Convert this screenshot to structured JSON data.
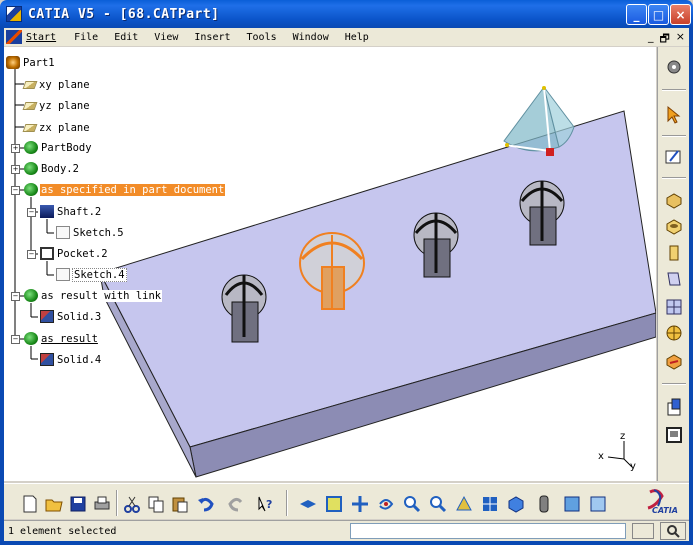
{
  "window": {
    "title": "CATIA V5 - [68.CATPart]",
    "min_symbol": "_",
    "max_symbol": "□",
    "close_symbol": "×"
  },
  "menu": {
    "items": [
      "Start",
      "File",
      "Edit",
      "View",
      "Insert",
      "Tools",
      "Window",
      "Help"
    ],
    "mdi_min": "_",
    "mdi_restore": "🗗",
    "mdi_close": "×"
  },
  "tree": {
    "root": "Part1",
    "nodes": [
      {
        "label": "xy plane",
        "icon": "plane-icon"
      },
      {
        "label": "yz plane",
        "icon": "plane-icon"
      },
      {
        "label": "zx plane",
        "icon": "plane-icon"
      },
      {
        "label": "PartBody",
        "icon": "body-icon"
      },
      {
        "label": "Body.2",
        "icon": "body-icon"
      },
      {
        "label": "as specified in part document",
        "icon": "body-icon"
      },
      {
        "label": "Shaft.2",
        "icon": "shaft-icon"
      },
      {
        "label": "Sketch.5",
        "icon": "sketch-icon"
      },
      {
        "label": "Pocket.2",
        "icon": "pocket-icon"
      },
      {
        "label": "Sketch.4",
        "icon": "sketch-icon"
      },
      {
        "label": "as result with link",
        "icon": "body-icon"
      },
      {
        "label": "Solid.3",
        "icon": "solid-icon"
      },
      {
        "label": "as result",
        "icon": "body-icon"
      },
      {
        "label": "Solid.4",
        "icon": "solid-icon"
      }
    ],
    "highlight_color": "#f28c28"
  },
  "compass": {
    "x": "x",
    "y": "y",
    "z": "z"
  },
  "colors": {
    "plate_top": "#c8c8f0",
    "plate_side": "#9090b8",
    "selection": "#f08020",
    "title_blue": "#0a54c9"
  },
  "status": {
    "text": "1 element selected",
    "command_value": ""
  },
  "logo": {
    "text": "CATIA"
  }
}
